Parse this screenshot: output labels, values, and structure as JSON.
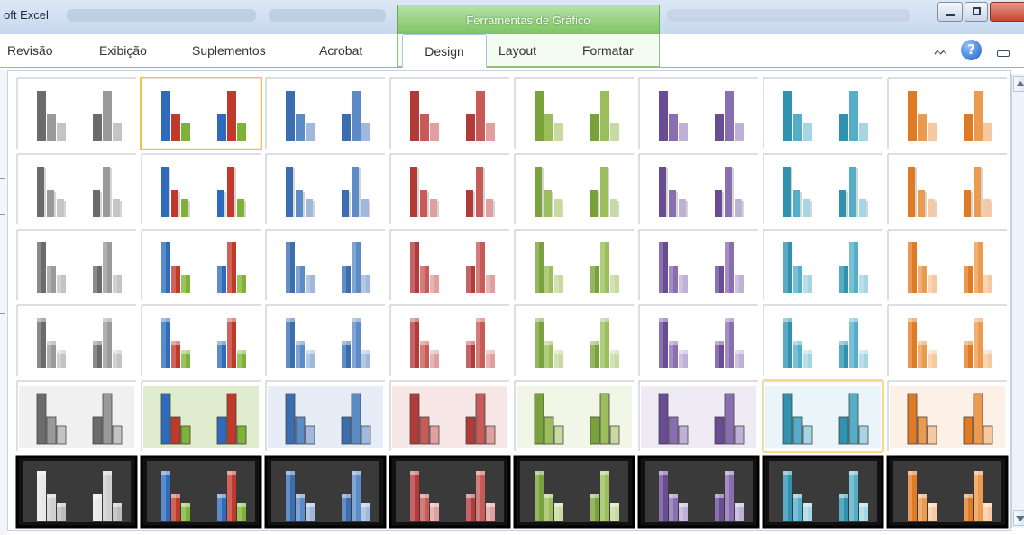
{
  "window": {
    "app_title": "oft Excel",
    "context_group_label": "Ferramentas de Gráfico",
    "min_icon": "minimize-icon",
    "max_icon": "maximize-icon",
    "close_icon": "close-icon"
  },
  "tabs": {
    "revisao": "Revisão",
    "exibicao": "Exibição",
    "suplementos": "Suplementos",
    "acrobat": "Acrobat",
    "design": "Design",
    "layout": "Layout",
    "formatar": "Formatar"
  },
  "ribbon_icons": {
    "collapse": "collapse-ribbon-icon",
    "collapse_glyph": "ᨓ",
    "help": "help-icon",
    "help_glyph": "?",
    "restore": "restore-window-icon"
  },
  "gallery": {
    "selected_style": 2,
    "hovered_style": 39,
    "palettes": [
      {
        "name": "gray",
        "main": "#6b6b6b",
        "second": "#9a9a9a",
        "third": "#c4c4c4"
      },
      {
        "name": "multi",
        "main": "#2f6bbd",
        "second": "#c0392b",
        "third": "#7fb236"
      },
      {
        "name": "blue",
        "main": "#3a6eb0",
        "second": "#5d8bc5",
        "third": "#9fb8dc"
      },
      {
        "name": "red",
        "main": "#b23a39",
        "second": "#c85a57",
        "third": "#e0a09f"
      },
      {
        "name": "green",
        "main": "#79a23a",
        "second": "#9bbd5c",
        "third": "#c6daa1"
      },
      {
        "name": "purple",
        "main": "#6a4c95",
        "second": "#8a6eb2",
        "third": "#bfb0d6"
      },
      {
        "name": "teal",
        "main": "#2f93b0",
        "second": "#55aec7",
        "third": "#a6d6e4"
      },
      {
        "name": "orange",
        "main": "#e07b24",
        "second": "#ec9a4d",
        "third": "#f6c9a0"
      }
    ],
    "row_styles": [
      "flat",
      "thin",
      "gradient",
      "bevel",
      "outlined-background",
      "dark-background"
    ]
  },
  "scrollbar": {
    "up_icon": "scroll-up-icon",
    "down_icon": "scroll-down-icon"
  }
}
